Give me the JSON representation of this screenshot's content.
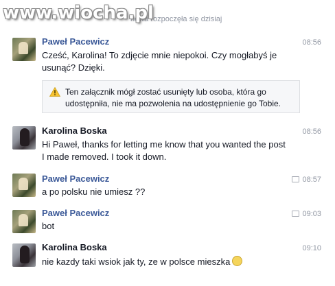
{
  "watermark": "www.wiocha.pl",
  "conversation_started": "nowa rozpoczęła się dzisiaj",
  "messages": [
    {
      "sender": "Paweł Pacewicz",
      "time": "08:56",
      "text": "Cześć, Karolina! To zdjęcie mnie niepokoi. Czy mogłabyś je usunąć? Dzięki.",
      "attachment_notice": "Ten załącznik mógł zostać usunięty lub osoba, która go udostępniła, nie ma pozwolenia na udostępnienie go Tobie."
    },
    {
      "sender": "Karolina Boska",
      "time": "08:56",
      "text": "Hi Paweł, thanks for letting me know that you wanted the post I made removed. I took it down."
    },
    {
      "sender": "Paweł Pacewicz",
      "time": "08:57",
      "text": "a po polsku nie umiesz ??"
    },
    {
      "sender": "Paweł Pacewicz",
      "time": "09:03",
      "text": "bot"
    },
    {
      "sender": "Karolina Boska",
      "time": "09:10",
      "text": "nie kazdy taki wsiok jak ty, ze w polsce mieszka"
    }
  ],
  "icons": {
    "warning": "warning-triangle-icon",
    "sent": "message-sent-icon",
    "emoji": "smiley-icon"
  },
  "colors": {
    "name_link": "#3b5998",
    "timestamp": "#9197a3",
    "warning": "#f7c331"
  }
}
